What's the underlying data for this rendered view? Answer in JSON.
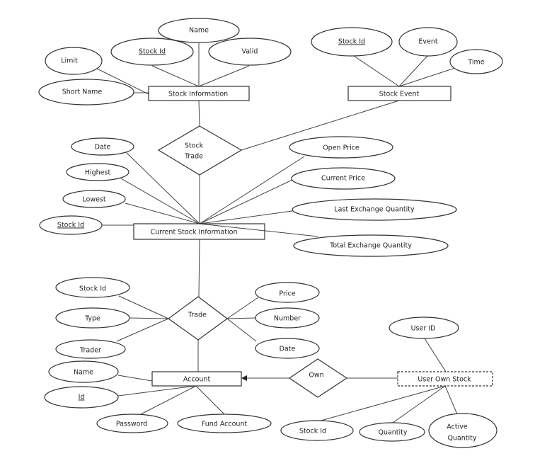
{
  "entities": {
    "stock_information": "Stock Information",
    "stock_event": "Stock Event",
    "current_stock_information": "Current Stock Information",
    "account": "Account",
    "user_own_stock": "User Own Stock"
  },
  "relationships": {
    "stock_trade_line1": "Stock",
    "stock_trade_line2": "Trade",
    "trade": "Trade",
    "own": "Own"
  },
  "attributes": {
    "stock_information": {
      "name": "Name",
      "stock_id": "Stock Id",
      "valid": "Valid",
      "limit": "Limit",
      "short_name": "Short Name"
    },
    "stock_event": {
      "stock_id": "Stock Id",
      "event": "Event",
      "time": "Time"
    },
    "current_stock_information": {
      "date": "Date",
      "highest": "Highest",
      "lowest": "Lowest",
      "stock_id": "Stock Id",
      "open_price": "Open Price",
      "current_price": "Current Price",
      "last_exchange_quantity": "Last Exchange Quantity",
      "total_exchange_quantity": "Total Exchange Quantity"
    },
    "trade": {
      "stock_id": "Stock Id",
      "type": "Type",
      "trader": "Trader",
      "price": "Price",
      "number": "Number",
      "date": "Date"
    },
    "account": {
      "name": "Name",
      "id": "Id",
      "password": "Password",
      "fund_account": "Fund Account"
    },
    "user_own_stock": {
      "user_id": "User ID",
      "stock_id": "Stock Id",
      "quantity": "Quantity",
      "active_quantity_line1": "Active",
      "active_quantity_line2": "Quantity"
    }
  },
  "key_attributes": [
    "stock_information.stock_id",
    "stock_event.stock_id",
    "current_stock_information.stock_id",
    "account.id"
  ],
  "weak_entities": [
    "user_own_stock"
  ]
}
